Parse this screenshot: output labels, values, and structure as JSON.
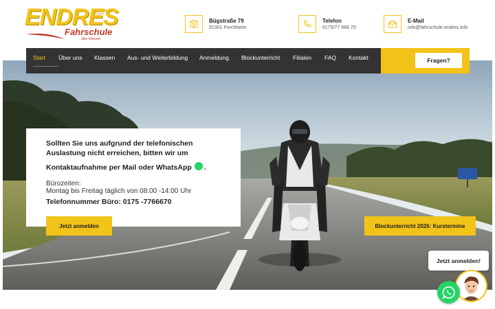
{
  "brand": {
    "name": "ENDRES",
    "sub": "Fahrschule",
    "tagline": "aller Klassen",
    "mini": "Inhaber A. Endres",
    "accent": "#f2c318",
    "dark": "#333333"
  },
  "contacts": [
    {
      "icon": "building-icon",
      "title": "Bügstraße 79",
      "detail": "91301 Forchheim"
    },
    {
      "icon": "phone-icon",
      "title": "Telefon",
      "detail": "0175/77 666 70"
    },
    {
      "icon": "mail-icon",
      "title": "E-Mail",
      "detail": "info@fahrschule-endres.info"
    }
  ],
  "nav": {
    "items": [
      "Start",
      "Über uns",
      "Klassen",
      "Aus- und Weiterbildung",
      "Anmeldung",
      "Blockunterricht",
      "Filialen",
      "FAQ",
      "Kontakt"
    ],
    "active": "Start",
    "cta": "Fragen?"
  },
  "hero": {
    "lead": "Sollten Sie uns aufgrund der telefonischen Auslastung nicht erreichen, bitten wir um",
    "lead2": "Kontaktaufnahme per Mail oder WhatsApp",
    "lead2_end": ".",
    "hours_label": "Bürozeiten:",
    "hours": "Montag bis Freitag täglich von 08:00 -14:00 Uhr",
    "phone": "Telefonnummer Büro:  0175 -7766670",
    "apply_button": "Jetzt anmelden",
    "block_button": "Blockunterricht 2026: Kurstermine"
  },
  "widgets": {
    "bubble": "Jetzt anmelden!",
    "whatsapp_color": "#25d366"
  }
}
